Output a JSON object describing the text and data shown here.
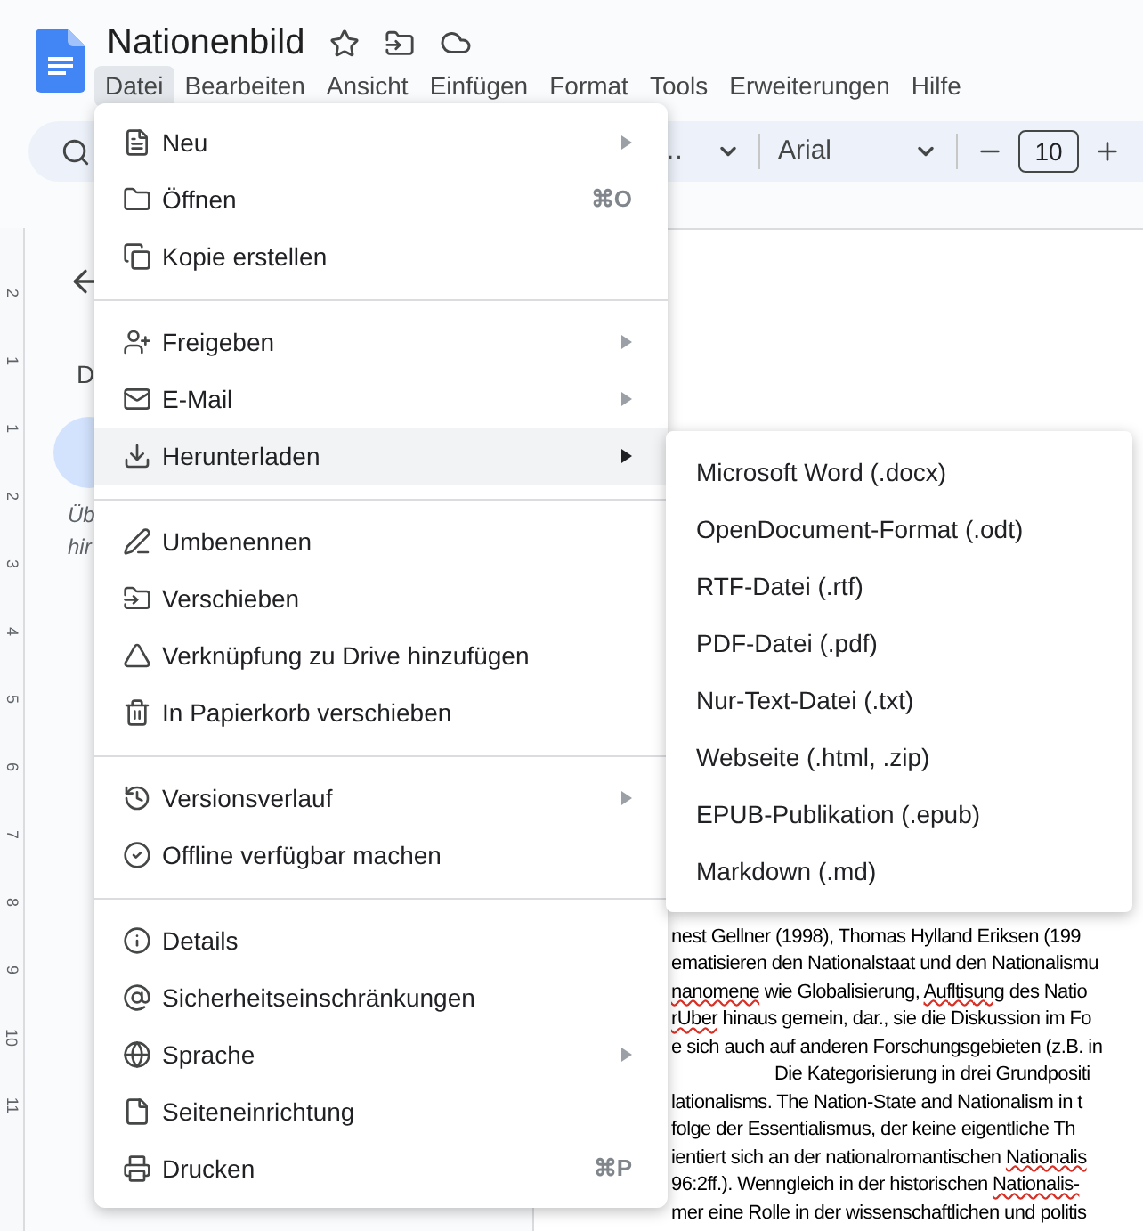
{
  "app": {
    "title": "Nationenbild"
  },
  "menu_bar": [
    {
      "label": "Datei",
      "selected": true
    },
    {
      "label": "Bearbeiten",
      "selected": false
    },
    {
      "label": "Ansicht",
      "selected": false
    },
    {
      "label": "Einfügen",
      "selected": false
    },
    {
      "label": "Format",
      "selected": false
    },
    {
      "label": "Tools",
      "selected": false
    },
    {
      "label": "Erweiterungen",
      "selected": false
    },
    {
      "label": "Hilfe",
      "selected": false
    }
  ],
  "toolbar": {
    "style_value": "…",
    "font": "Arial",
    "font_size": "10"
  },
  "ruler": [
    "2",
    "1",
    "1",
    "2",
    "3",
    "4",
    "5",
    "6",
    "7",
    "8",
    "9",
    "10",
    "11"
  ],
  "sidebar": {
    "initial": "D",
    "note_lines": [
      "Üb",
      "hir"
    ]
  },
  "file_menu": [
    [
      {
        "label": "Neu",
        "kind": "new",
        "submenu": true,
        "selected": false
      },
      {
        "label": "Öffnen",
        "kind": "open",
        "shortcut": "⌘O",
        "selected": false
      },
      {
        "label": "Kopie erstellen",
        "kind": "copy",
        "selected": false
      }
    ],
    [
      {
        "label": "Freigeben",
        "kind": "share",
        "submenu": true,
        "selected": false
      },
      {
        "label": "E-Mail",
        "kind": "mail",
        "submenu": true,
        "selected": false
      },
      {
        "label": "Herunterladen",
        "kind": "download",
        "submenu": true,
        "selected": true
      }
    ],
    [
      {
        "label": "Umbenennen",
        "kind": "rename",
        "selected": false
      },
      {
        "label": "Verschieben",
        "kind": "move",
        "selected": false
      },
      {
        "label": "Verknüpfung zu Drive hinzufügen",
        "kind": "shortcut",
        "selected": false
      },
      {
        "label": "In Papierkorb verschieben",
        "kind": "trash",
        "selected": false
      }
    ],
    [
      {
        "label": "Versionsverlauf",
        "kind": "history",
        "submenu": true,
        "selected": false
      },
      {
        "label": "Offline verfügbar machen",
        "kind": "offline",
        "selected": false
      }
    ],
    [
      {
        "label": "Details",
        "kind": "info",
        "selected": false
      },
      {
        "label": "Sicherheitseinschränkungen",
        "kind": "security",
        "selected": false
      },
      {
        "label": "Sprache",
        "kind": "language",
        "submenu": true,
        "selected": false
      },
      {
        "label": "Seiteneinrichtung",
        "kind": "page",
        "selected": false
      },
      {
        "label": "Drucken",
        "kind": "print",
        "shortcut": "⌘P",
        "selected": false
      }
    ]
  ],
  "download_submenu": [
    "Microsoft Word (.docx)",
    "OpenDocument-Format (.odt)",
    "RTF-Datei (.rtf)",
    "PDF-Datei (.pdf)",
    "Nur-Text-Datei (.txt)",
    "Webseite (.html, .zip)",
    "EPUB-Publikation (.epub)",
    "Markdown (.md)"
  ],
  "document": {
    "lines": [
      {
        "parts": [
          {
            "text": "nest Gellner (1998), Thomas Hylland Eriksen (199",
            "flagged": false
          }
        ]
      },
      {
        "parts": [
          {
            "text": "ematisieren den Nationalstaat und den Nationalismu",
            "flagged": false
          }
        ]
      },
      {
        "parts": [
          {
            "text": "nanomene",
            "flagged": true
          },
          {
            "text": " wie Globalisierung, ",
            "flagged": false
          },
          {
            "text": "Aufltisung",
            "flagged": true
          },
          {
            "text": " des Natio",
            "flagged": false
          }
        ]
      },
      {
        "parts": [
          {
            "text": "rUber",
            "flagged": true
          },
          {
            "text": " hinaus gemein, dar., sie die Diskussion im Fo",
            "flagged": false
          }
        ]
      },
      {
        "parts": [
          {
            "text": "e sich auch auf anderen Forschungsgebieten (z.B. in",
            "flagged": false
          }
        ]
      },
      {
        "indent": true,
        "parts": [
          {
            "text": "Die Kategorisierung in drei Grundpositi",
            "flagged": false
          }
        ]
      },
      {
        "parts": [
          {
            "text": "lationalisms. The Nation-State and Nationalism in t",
            "flagged": false
          }
        ]
      },
      {
        "parts": [
          {
            "text": "folge der Essentialismus, der keine eigentliche Th",
            "flagged": false
          }
        ]
      },
      {
        "parts": [
          {
            "text": "ientiert sich an der nationalromantischen ",
            "flagged": false
          },
          {
            "text": "Nationalis",
            "flagged": true
          }
        ]
      },
      {
        "parts": [
          {
            "text": "96:2ff.). Wenngleich in der historischen ",
            "flagged": false
          },
          {
            "text": "Nationalis-",
            "flagged": true
          }
        ]
      },
      {
        "parts": [
          {
            "text": "mer eine Rolle in der wissenschaftlichen und politis",
            "flagged": false
          }
        ]
      }
    ]
  }
}
